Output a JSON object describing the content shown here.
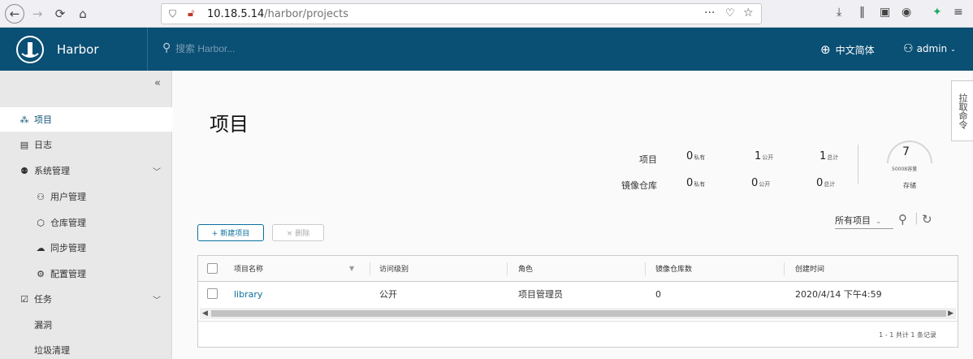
{
  "browser": {
    "url_host": "10.18.5.14",
    "url_path": "/harbor/projects",
    "icons": [
      "back-icon",
      "forward-icon",
      "reload-icon",
      "home-icon",
      "shield-icon",
      "insecure-lock-icon",
      "more-icon",
      "pocket-icon",
      "star-icon",
      "download-icon",
      "library-icon",
      "sidebar-icon",
      "account-icon",
      "extensions-icon",
      "menu-icon"
    ]
  },
  "header": {
    "app_name": "Harbor",
    "search_placeholder": "搜索 Harbor...",
    "language": "中文简体",
    "user": "admin"
  },
  "sidebar": {
    "collapse_icon": "«",
    "items": [
      {
        "label": "项目",
        "icon": "project-icon",
        "active": true
      },
      {
        "label": "日志",
        "icon": "log-icon"
      },
      {
        "label": "系统管理",
        "icon": "admin-icon"
      },
      {
        "label": "用户管理",
        "icon": "users-icon"
      },
      {
        "label": "仓库管理",
        "icon": "registry-icon"
      },
      {
        "label": "同步管理",
        "icon": "replication-icon"
      },
      {
        "label": "配置管理",
        "icon": "settings-icon"
      },
      {
        "label": "任务",
        "icon": "tasks-icon"
      },
      {
        "label": "漏洞"
      },
      {
        "label": "垃圾清理"
      }
    ]
  },
  "main": {
    "title": "项目",
    "side_tab": "拉取命令",
    "stats": {
      "row1_label": "项目",
      "row2_label": "镜像仓库",
      "private_label": "私有",
      "public_label": "公开",
      "total_label": "总计",
      "projects": {
        "private": "0",
        "public": "1",
        "total": "1"
      },
      "repos": {
        "private": "0",
        "public": "0",
        "total": "0"
      }
    },
    "storage": {
      "value": "7",
      "caption": "50008容量",
      "label": "存储",
      "used_fraction": 0.0
    },
    "buttons": {
      "new": "+ 新建项目",
      "delete": "× 删除"
    },
    "filter": "所有项目",
    "table": {
      "headers": [
        "项目名称",
        "访问级别",
        "角色",
        "镜像仓库数",
        "创建时间"
      ],
      "rows": [
        {
          "name": "library",
          "access": "公开",
          "role": "项目管理员",
          "repo_count": "0",
          "created": "2020/4/14 下午4:59"
        }
      ],
      "footer": "1 - 1 共计 1 条记录"
    }
  }
}
